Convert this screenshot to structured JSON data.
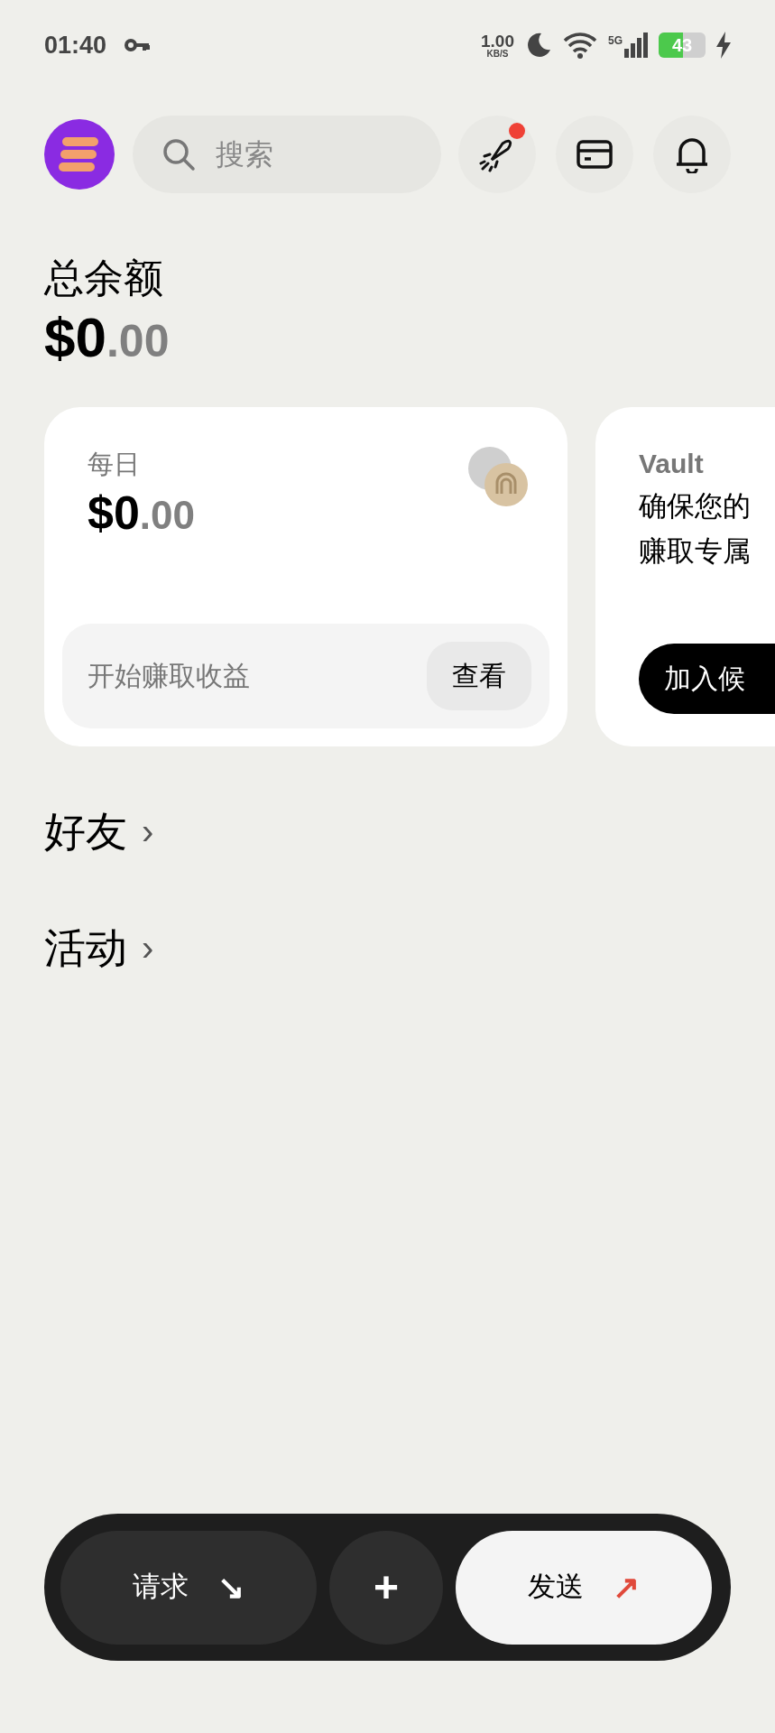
{
  "status_bar": {
    "time": "01:40",
    "speed_value": "1.00",
    "speed_unit": "KB/S",
    "network": "5G",
    "battery": "43"
  },
  "header": {
    "search": {
      "placeholder": "搜索"
    },
    "notification_dot": true
  },
  "balance": {
    "label": "总余额",
    "whole": "$0",
    "decimals": ".00"
  },
  "cards": [
    {
      "kind": "earn",
      "label": "每日",
      "whole": "$0",
      "decimals": ".00",
      "prompt": "开始赚取收益",
      "button": "查看"
    },
    {
      "kind": "vault",
      "title": "Vault",
      "lines": [
        "确保您的",
        "赚取专属"
      ],
      "button": "加入候"
    }
  ],
  "sections": [
    {
      "label": "好友",
      "chevron": "›"
    },
    {
      "label": "活动",
      "chevron": "›"
    }
  ],
  "actions": [
    {
      "kind": "dark",
      "label": "请求",
      "arrow": "↘"
    },
    {
      "kind": "round",
      "label": "+"
    },
    {
      "kind": "light",
      "label": "发送",
      "arrow": "↗"
    }
  ]
}
